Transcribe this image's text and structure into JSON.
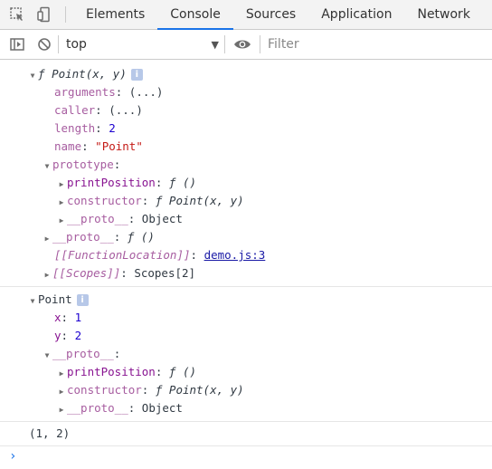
{
  "tabs": [
    "Elements",
    "Console",
    "Sources",
    "Application",
    "Network"
  ],
  "toolbar": {
    "context": "top",
    "filter_placeholder": "Filter"
  },
  "colors": {
    "accent": "#1a73e8",
    "property": "#881391",
    "number": "#1c00cf",
    "string": "#c41a16"
  },
  "icons": [
    "inspect-icon",
    "device-toggle-icon",
    "sidebar-toggle-icon",
    "clear-console-icon",
    "eye-icon",
    "chevron-down-icon",
    "info-icon",
    "prompt-chevron-icon"
  ],
  "msg1": {
    "f": "ƒ",
    "header": "Point(x, y)",
    "arguments": {
      "key": "arguments",
      "val": "(...)"
    },
    "caller": {
      "key": "caller",
      "val": "(...)"
    },
    "length": {
      "key": "length",
      "val": "2"
    },
    "name": {
      "key": "name",
      "val": "\"Point\""
    },
    "prototype": {
      "key": "prototype"
    },
    "printPosition": {
      "key": "printPosition",
      "val": "()"
    },
    "constructor": {
      "key": "constructor",
      "val": "Point(x, y)"
    },
    "proto_object": {
      "key": "__proto__",
      "val": "Object"
    },
    "proto_fn": {
      "key": "__proto__",
      "val": "()"
    },
    "functionLocation": {
      "key": "[[FunctionLocation]]",
      "val": "demo.js:3"
    },
    "scopes": {
      "key": "[[Scopes]]",
      "val": "Scopes[2]"
    }
  },
  "msg2": {
    "header": "Point",
    "x": {
      "key": "x",
      "val": "1"
    },
    "y": {
      "key": "y",
      "val": "2"
    },
    "proto": {
      "key": "__proto__"
    },
    "printPosition": {
      "key": "printPosition",
      "val": "()"
    },
    "constructor": {
      "key": "constructor",
      "val": "Point(x, y)"
    },
    "proto_object": {
      "key": "__proto__",
      "val": "Object"
    }
  },
  "msg3": {
    "text": "(1, 2)"
  }
}
